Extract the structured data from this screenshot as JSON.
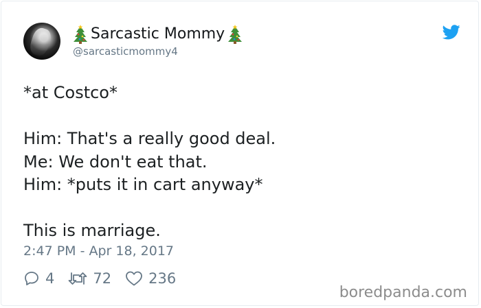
{
  "author": {
    "display_name": "Sarcastic Mommy",
    "handle": "@sarcasticmommy4",
    "emoji_icon": "christmas-tree-icon"
  },
  "tweet": {
    "lines": [
      "*at Costco*",
      "",
      "Him: That's a really good deal.",
      "Me: We don't eat that.",
      "Him: *puts it in cart anyway*",
      "",
      "This is marriage."
    ],
    "timestamp": "2:47 PM - Apr 18, 2017"
  },
  "actions": {
    "replies": "4",
    "retweets": "72",
    "likes": "236"
  },
  "watermark": "boredpanda.com",
  "colors": {
    "twitter_blue": "#1da1f2",
    "muted_gray": "#657786",
    "text": "#1c2022"
  }
}
